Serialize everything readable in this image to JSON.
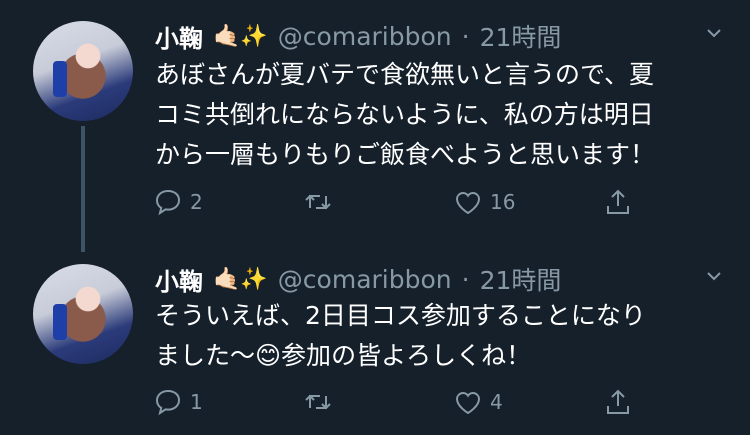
{
  "tweets": [
    {
      "name": "小鞠",
      "name_emojis": "🤙🏻✨",
      "handle": "@comaribbon",
      "separator": "·",
      "time": "21時間",
      "text": "あぼさんが夏バテで食欲無いと言うので、夏\nコミ共倒れにならないように、私の方は明日\nから一層もりもりご飯食べようと思います！",
      "reply_count": "2",
      "retweet_count": "",
      "like_count": "16"
    },
    {
      "name": "小鞠",
      "name_emojis": "🤙🏻✨",
      "handle": "@comaribbon",
      "separator": "·",
      "time": "21時間",
      "text": "そういえば、2日目コス参加することになり\nました〜😊参加の皆よろしくね！",
      "reply_count": "1",
      "retweet_count": "",
      "like_count": "4"
    }
  ],
  "icons": {
    "reply": "speech-bubble-icon",
    "retweet": "retweet-arrows-icon",
    "like": "heart-outline-icon",
    "share": "share-upload-icon",
    "more": "chevron-down-icon"
  },
  "colors": {
    "background": "#15202b",
    "secondary_text": "#8899a6",
    "thread_line": "#3d5466"
  }
}
